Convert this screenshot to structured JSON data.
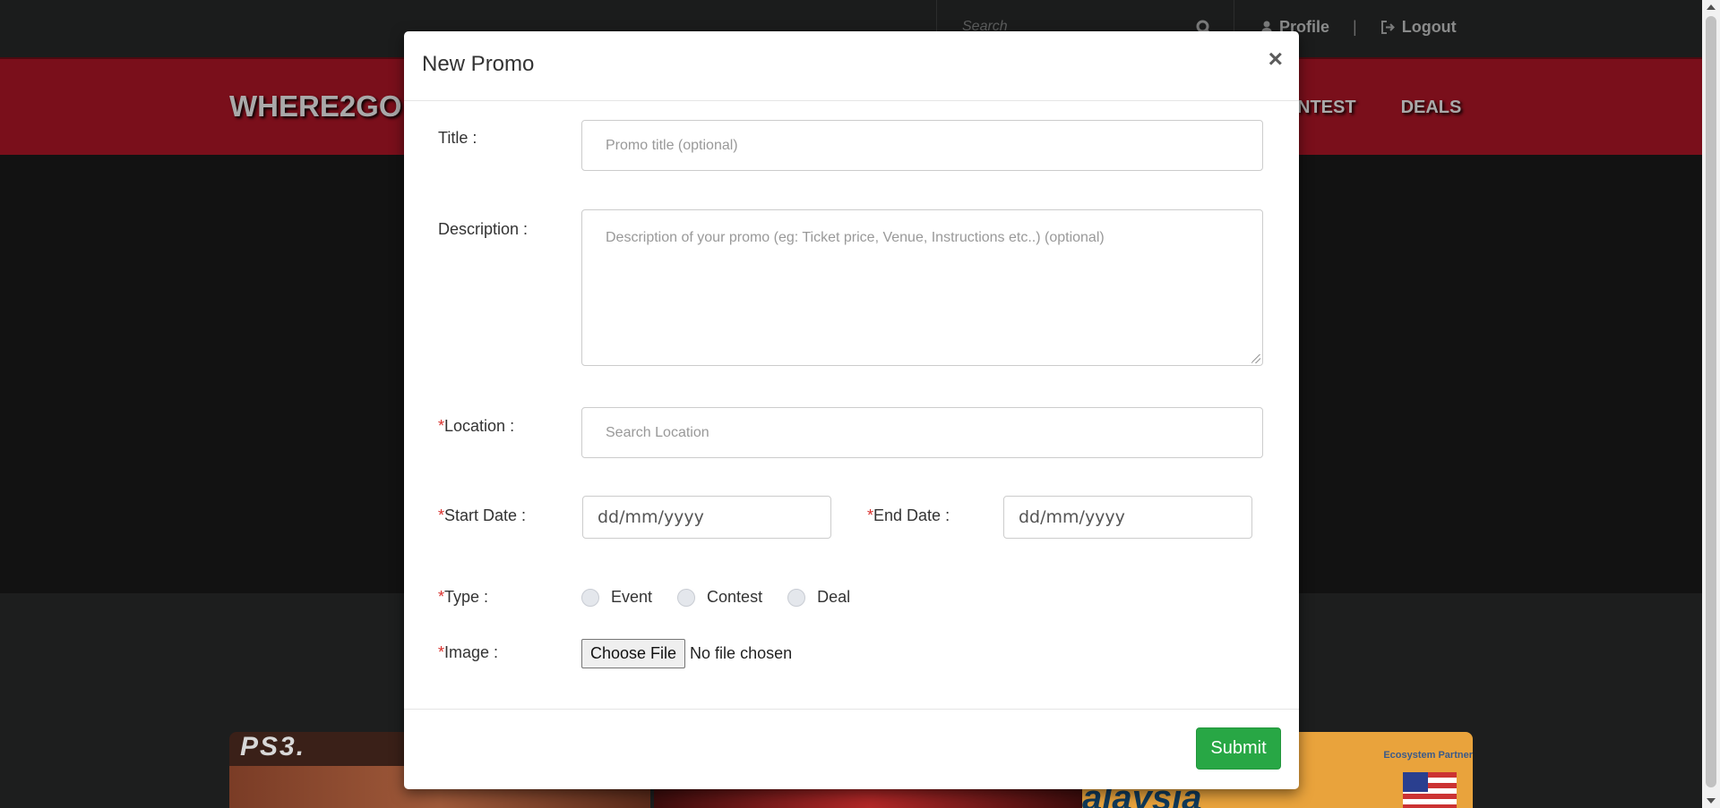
{
  "background": {
    "search_placeholder": "Search",
    "profile_label": "Profile",
    "separator": "|",
    "logout_label": "Logout",
    "logo": "WHERE2GO",
    "nav": [
      "NTEST",
      "DEALS"
    ],
    "card1_text": "PS3.",
    "card3_badge": "Ecosystem Partner",
    "card3_text": "alaysia"
  },
  "modal": {
    "title": "New Promo",
    "close": "×",
    "fields": {
      "title_label": "Title :",
      "title_placeholder": "Promo title (optional)",
      "description_label": "Description :",
      "description_placeholder": "Description of your promo (eg: Ticket price, Venue, Instructions etc..) (optional)",
      "location_label": "Location :",
      "location_placeholder": "Search Location",
      "start_date_label": "Start Date :",
      "start_date_value": "dd/mm/yyyy",
      "end_date_label": "End Date :",
      "end_date_value": "dd/mm/yyyy",
      "type_label": "Type :",
      "type_options": [
        "Event",
        "Contest",
        "Deal"
      ],
      "image_label": "Image :",
      "file_button": "Choose File",
      "file_status": "No file chosen"
    },
    "required_marker": "*",
    "submit_label": "Submit"
  },
  "colors": {
    "brand_red": "#7a0f1b",
    "submit_green": "#28a745",
    "required_red": "#d9302c"
  }
}
